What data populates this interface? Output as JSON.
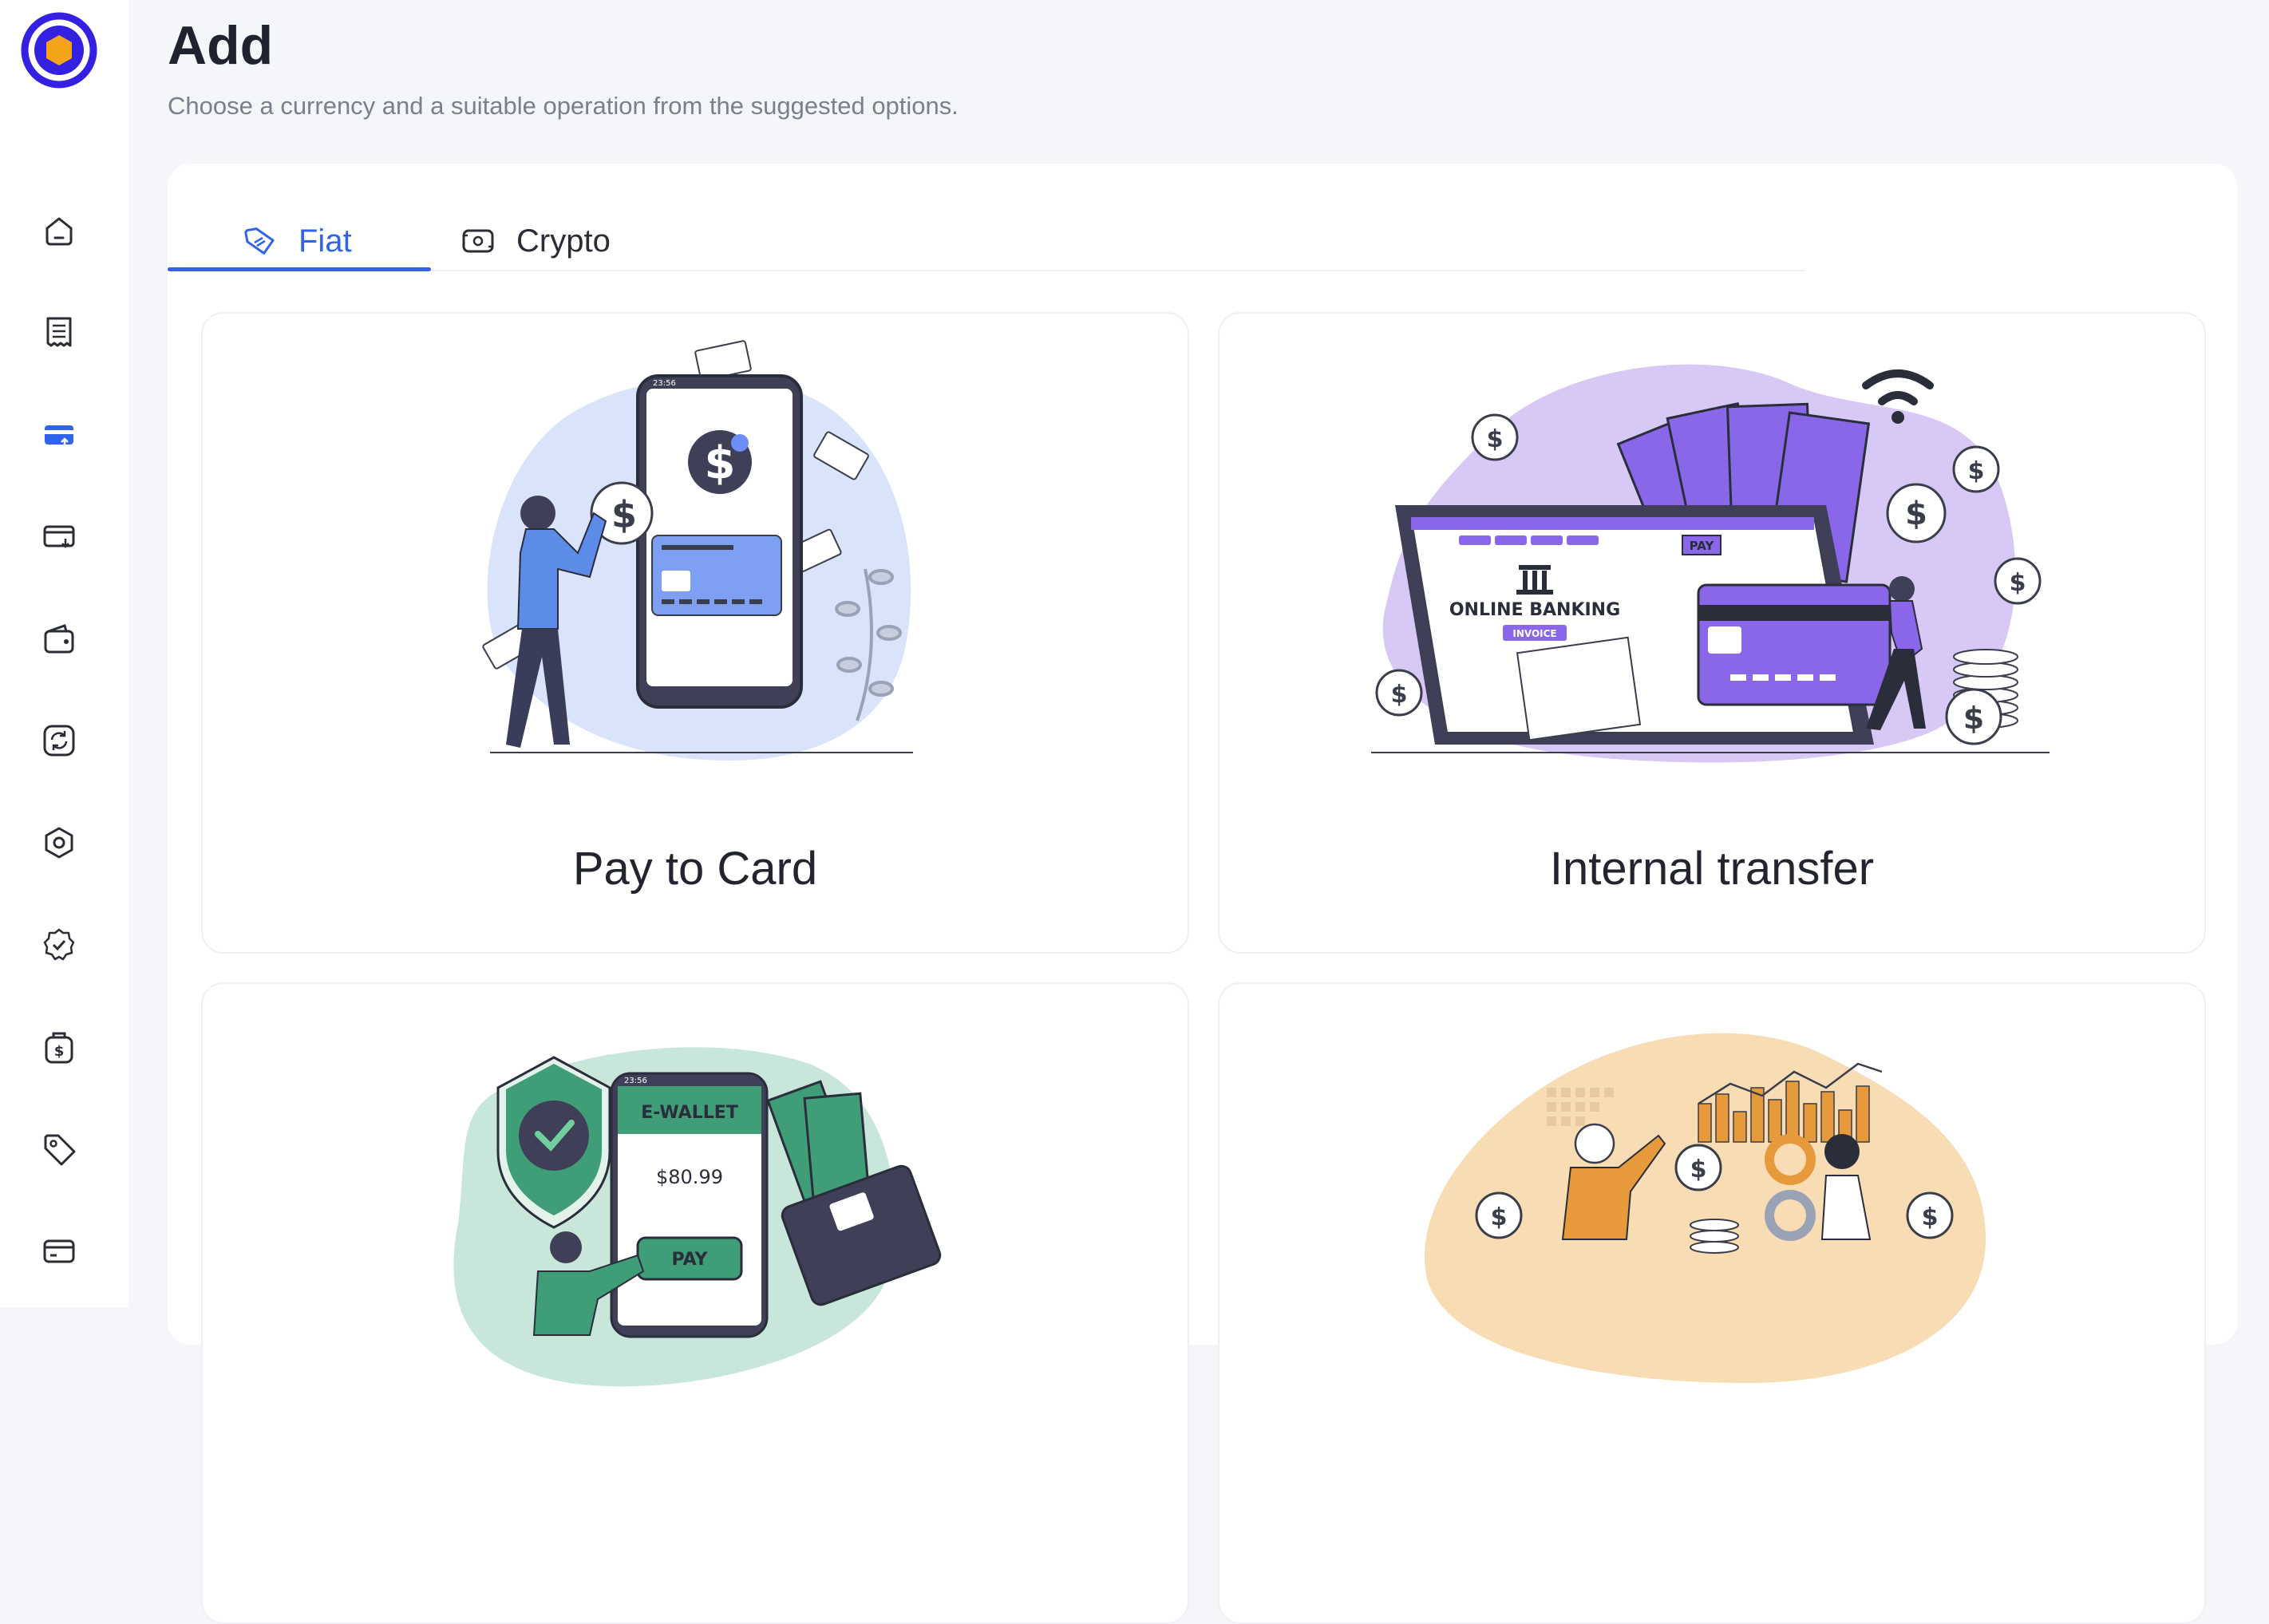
{
  "page": {
    "title": "Add",
    "subtitle": "Choose a currency and a suitable operation from the suggested options."
  },
  "colors": {
    "accent": "#2f64e8",
    "logo_ring": "#3320e0",
    "logo_hex": "#f5a31a",
    "blue_blob": "#d9e4fb",
    "purple_blob": "#d7c8f5",
    "green_blob": "#c8e6da",
    "orange_blob": "#f7dcb4"
  },
  "sidebar": {
    "items": [
      {
        "icon": "home-icon",
        "active": false
      },
      {
        "icon": "receipt-icon",
        "active": false
      },
      {
        "icon": "card-add-icon",
        "active": true
      },
      {
        "icon": "card-withdraw-icon",
        "active": false
      },
      {
        "icon": "wallet-icon",
        "active": false
      },
      {
        "icon": "exchange-icon",
        "active": false
      },
      {
        "icon": "hexagon-icon",
        "active": false
      },
      {
        "icon": "verified-badge-icon",
        "active": false
      },
      {
        "icon": "money-bag-icon",
        "active": false
      },
      {
        "icon": "tag-icon",
        "active": false
      },
      {
        "icon": "card-icon",
        "active": false
      }
    ]
  },
  "tabs": [
    {
      "label": "Fiat",
      "icon": "tag-icon",
      "active": true
    },
    {
      "label": "Crypto",
      "icon": "crypto-card-icon",
      "active": false
    }
  ],
  "cards": [
    {
      "title": "Pay to Card",
      "illustration": "phone-payment-illustration"
    },
    {
      "title": "Internal transfer",
      "illustration": "online-banking-illustration"
    },
    {
      "title": "",
      "illustration": "e-wallet-illustration",
      "ewallet": {
        "header": "E-WALLET",
        "amount": "$80.99",
        "pay": "PAY",
        "time": "23:56"
      }
    },
    {
      "title": "",
      "illustration": "business-growth-illustration"
    }
  ],
  "illustration_text": {
    "phone_time": "23:56",
    "online_banking": "ONLINE BANKING",
    "invoice": "INVOICE",
    "pay": "PAY"
  }
}
